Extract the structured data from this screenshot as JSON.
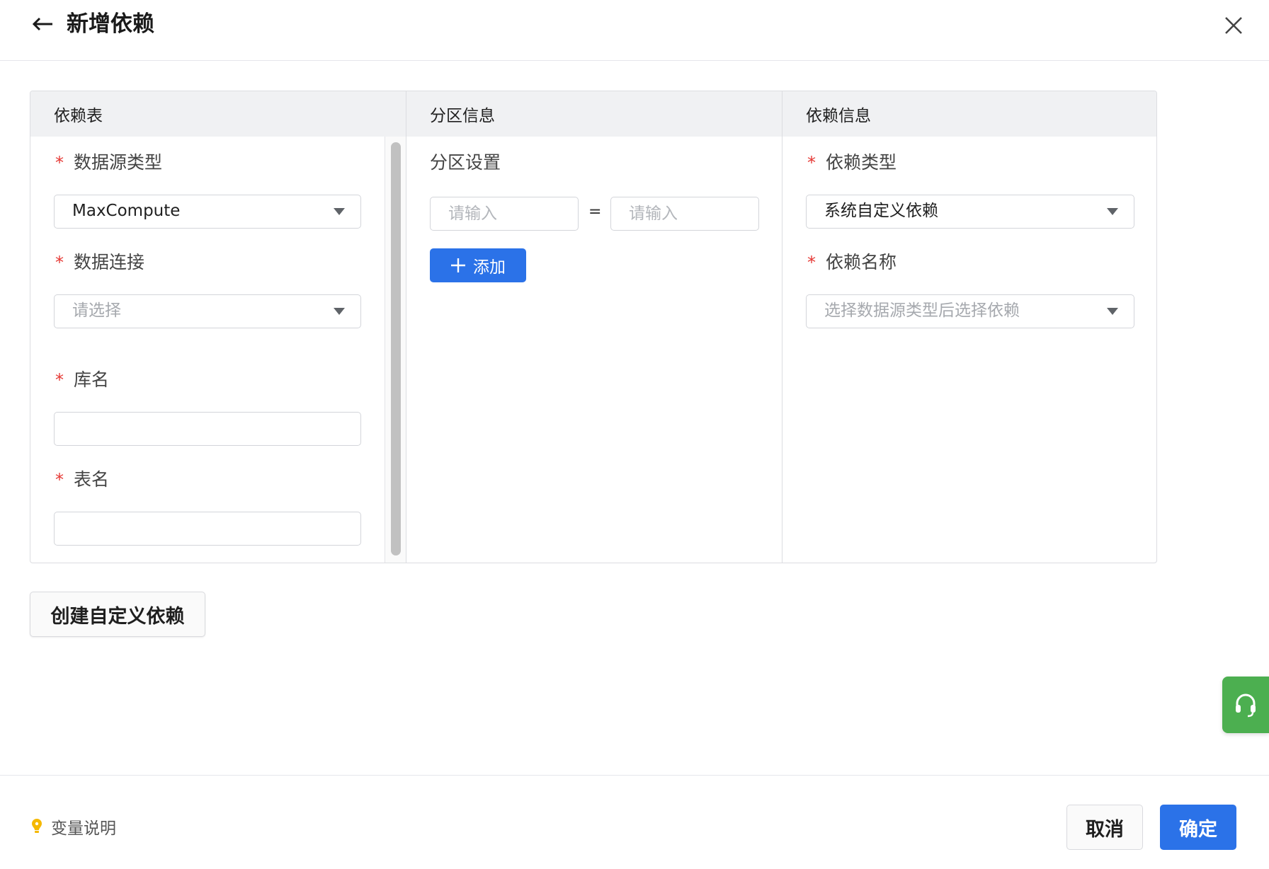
{
  "header": {
    "title": "新增依赖",
    "back_icon": "arrow-left-icon",
    "close_icon": "close-icon"
  },
  "dep_table": {
    "col_dep_table": {
      "title": "依赖表",
      "fields": {
        "source_type": {
          "label": "数据源类型",
          "value": "MaxCompute"
        },
        "connection": {
          "label": "数据连接",
          "placeholder": "请选择"
        },
        "db_name": {
          "label": "库名",
          "value": ""
        },
        "table_name": {
          "label": "表名",
          "value": ""
        }
      }
    },
    "col_partition": {
      "title": "分区信息",
      "setting_label": "分区设置",
      "key_placeholder": "请输入",
      "equals": "=",
      "value_placeholder": "请输入",
      "add_label": "添加"
    },
    "col_dep_info": {
      "title": "依赖信息",
      "dep_type": {
        "label": "依赖类型",
        "value": "系统自定义依赖"
      },
      "dep_name": {
        "label": "依赖名称",
        "placeholder": "选择数据源类型后选择依赖"
      }
    }
  },
  "required_mark": "*",
  "create_custom_label": "创建自定义依赖",
  "footer": {
    "var_label": "变量说明",
    "cancel_label": "取消",
    "ok_label": "确定"
  },
  "colors": {
    "primary": "#2b72e8",
    "required": "#e53935",
    "support": "#4caf50",
    "bulb": "#f5b800"
  }
}
